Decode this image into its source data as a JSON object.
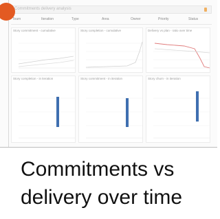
{
  "title_hint": "Commitments delivery analysis",
  "filters": [
    "Team",
    "Iteration",
    "Type",
    "Area",
    "Owner",
    "Priority",
    "Status"
  ],
  "panels": [
    {
      "title": "Story commitment - cumulative"
    },
    {
      "title": "Story completion - cumulative"
    },
    {
      "title": "Delivery vs plan - ratio over time"
    },
    {
      "title": "Story completion - in iteration"
    },
    {
      "title": "Story commitment - in iteration"
    },
    {
      "title": "Story churn - in iteration"
    }
  ],
  "caption": {
    "line1": "Commitments vs",
    "line2": "delivery over time"
  },
  "colors": {
    "bar": "#3f6fb0",
    "line_gray": "#c8c8c8",
    "line_red": "#e07a7a",
    "record": "#e35a22"
  }
}
